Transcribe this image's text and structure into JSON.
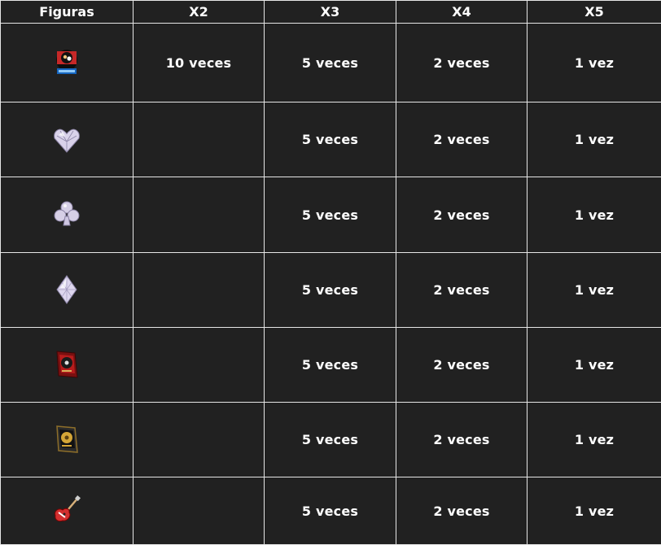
{
  "columns": [
    "Figuras",
    "X2",
    "X3",
    "X4",
    "X5"
  ],
  "rows": [
    {
      "icon": "logo-icon",
      "x2": "10 veces",
      "x3": "5 veces",
      "x4": "2 veces",
      "x5": "1 vez"
    },
    {
      "icon": "diamond-heart-icon",
      "x2": "",
      "x3": "5 veces",
      "x4": "2 veces",
      "x5": "1 vez"
    },
    {
      "icon": "diamond-club-icon",
      "x2": "",
      "x3": "5 veces",
      "x4": "2 veces",
      "x5": "1 vez"
    },
    {
      "icon": "diamond-gem-icon",
      "x2": "",
      "x3": "5 veces",
      "x4": "2 veces",
      "x5": "1 vez"
    },
    {
      "icon": "red-record-plaque-icon",
      "x2": "",
      "x3": "5 veces",
      "x4": "2 veces",
      "x5": "1 vez"
    },
    {
      "icon": "gold-record-plaque-icon",
      "x2": "",
      "x3": "5 veces",
      "x4": "2 veces",
      "x5": "1 vez"
    },
    {
      "icon": "electric-guitar-icon",
      "x2": "",
      "x3": "5 veces",
      "x4": "2 veces",
      "x5": "1 vez"
    }
  ],
  "colors": {
    "background": "#212121",
    "text": "#ffffff",
    "grid": "#e6e6e6"
  }
}
